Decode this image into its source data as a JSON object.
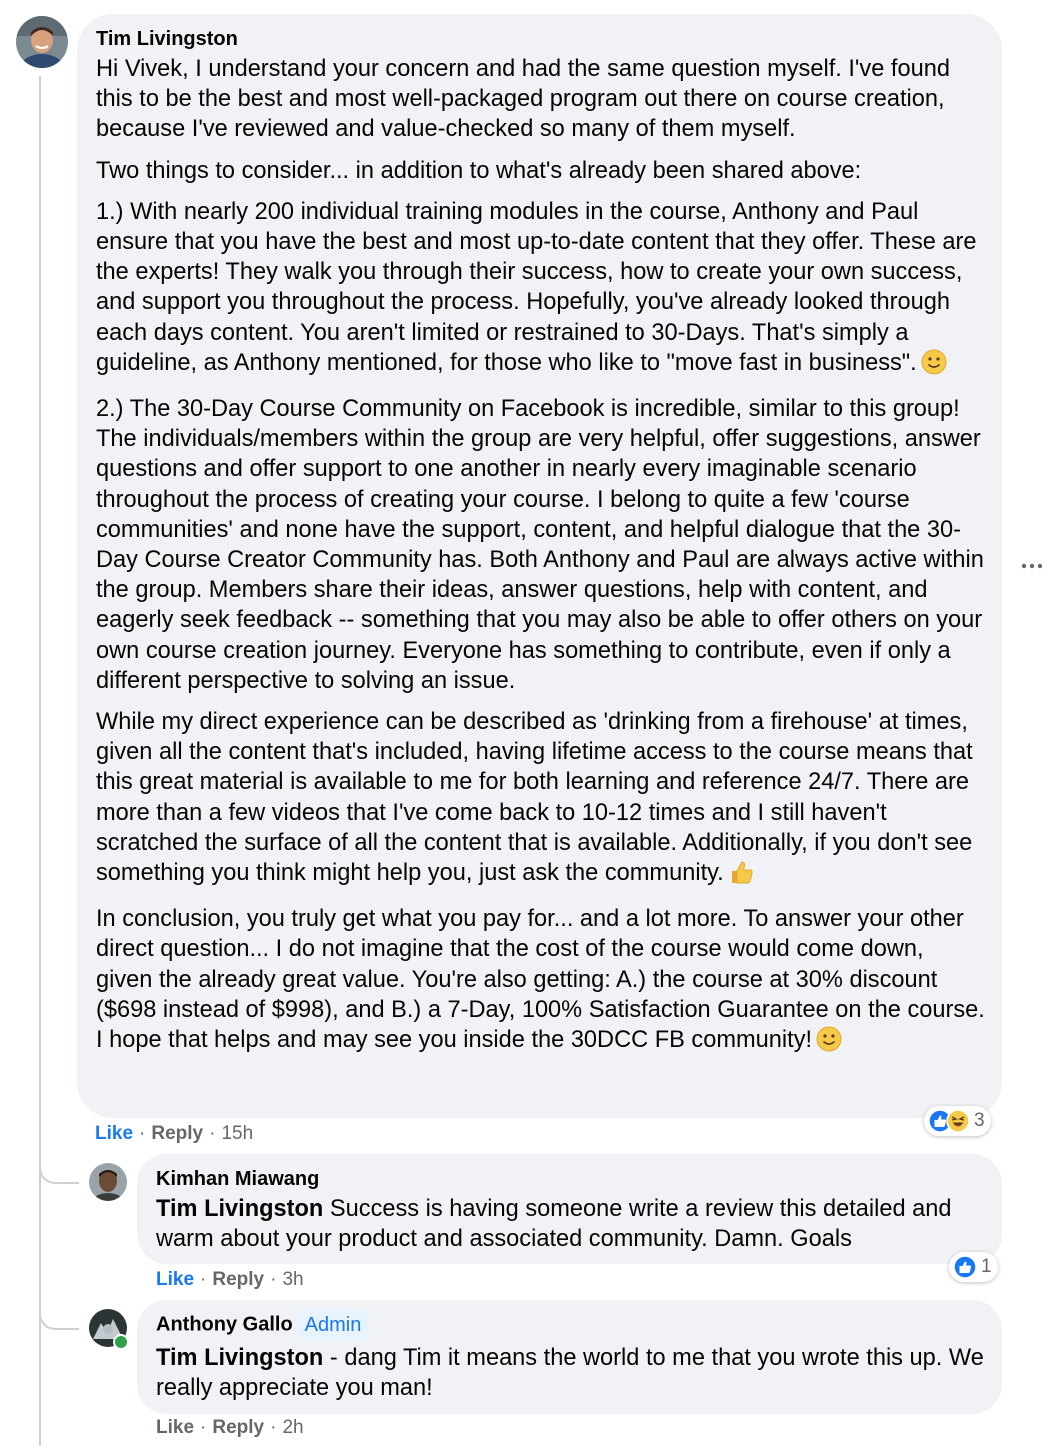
{
  "comments": [
    {
      "author": "Tim Livingston",
      "paragraphs": [
        "Hi Vivek, I understand your concern and had the same question myself. I've found this to be the best and most well-packaged program out there on course creation, because I've reviewed and value-checked so many of them myself.",
        "Two things to consider... in addition to what's already been shared above:",
        "1.) With nearly 200 individual training modules in the course, Anthony and Paul ensure that you have the best and most up-to-date content that they offer. These are the experts! They walk you through their success, how to create your own success, and support you throughout the process. Hopefully, you've already looked through each days content. You aren't limited or restrained to 30-Days. That's simply a guideline, as Anthony mentioned, for those who like to \"move fast in business\".",
        "2.) The 30-Day Course Community on Facebook is incredible, similar to this group! The individuals/members within the group are very helpful, offer suggestions, answer questions and offer support to one another in nearly every imaginable scenario throughout the process of creating your course. I belong to quite a few 'course communities' and none have the support, content, and helpful dialogue that the 30-Day Course Creator Community has. Both Anthony and Paul are always active within the group. Members share their ideas, answer questions, help with content, and eagerly seek feedback -- something that you may also be able to offer others on your own course creation journey. Everyone has something to contribute, even if only a different perspective to solving an issue.",
        "While my direct experience can be described as 'drinking from a firehouse' at times, given all the content that's included, having lifetime access to the course means that this great material is available to me for both learning and reference 24/7. There are more than a few videos that I've come back to 10-12 times and I still haven't scratched the surface of all the content that is available. Additionally, if you don't see something you think might help you, just ask the community.",
        "In conclusion, you truly get what you pay for... and a lot more. To answer your other direct question... I do not imagine that the cost of the course would come down, given the already great value. You're also getting: A.) the course at 30% discount ($698 instead of $998), and B.) a 7-Day, 100% Satisfaction Guarantee on the course. I hope that helps and may see you inside the 30DCC FB community!"
      ],
      "like_label": "Like",
      "reply_label": "Reply",
      "time": "15h",
      "reaction_count": "3"
    },
    {
      "author": "Kimhan Miawang",
      "mention": "Tim Livingston",
      "text": "Success is having someone write a review this detailed and warm about your product and associated community. Damn. Goals",
      "like_label": "Like",
      "reply_label": "Reply",
      "time": "3h",
      "reaction_count": "1"
    },
    {
      "author": "Anthony Gallo",
      "badge": "Admin",
      "mention": "Tim Livingston",
      "text": "- dang Tim it means the world to me that you wrote this up. We really appreciate you man!",
      "like_label": "Like",
      "reply_label": "Reply",
      "time": "2h"
    }
  ],
  "separator": "·",
  "colors": {
    "bubble": "#f0f2f5",
    "link": "#1877f2",
    "meta": "#65676b",
    "text": "#050505",
    "admin_badge_bg": "#e7f3ff"
  },
  "icons": [
    "more-options-icon",
    "like-reaction-icon",
    "haha-reaction-icon",
    "slightly-smiling-face-emoji",
    "thumbs-up-emoji",
    "online-status-dot"
  ]
}
